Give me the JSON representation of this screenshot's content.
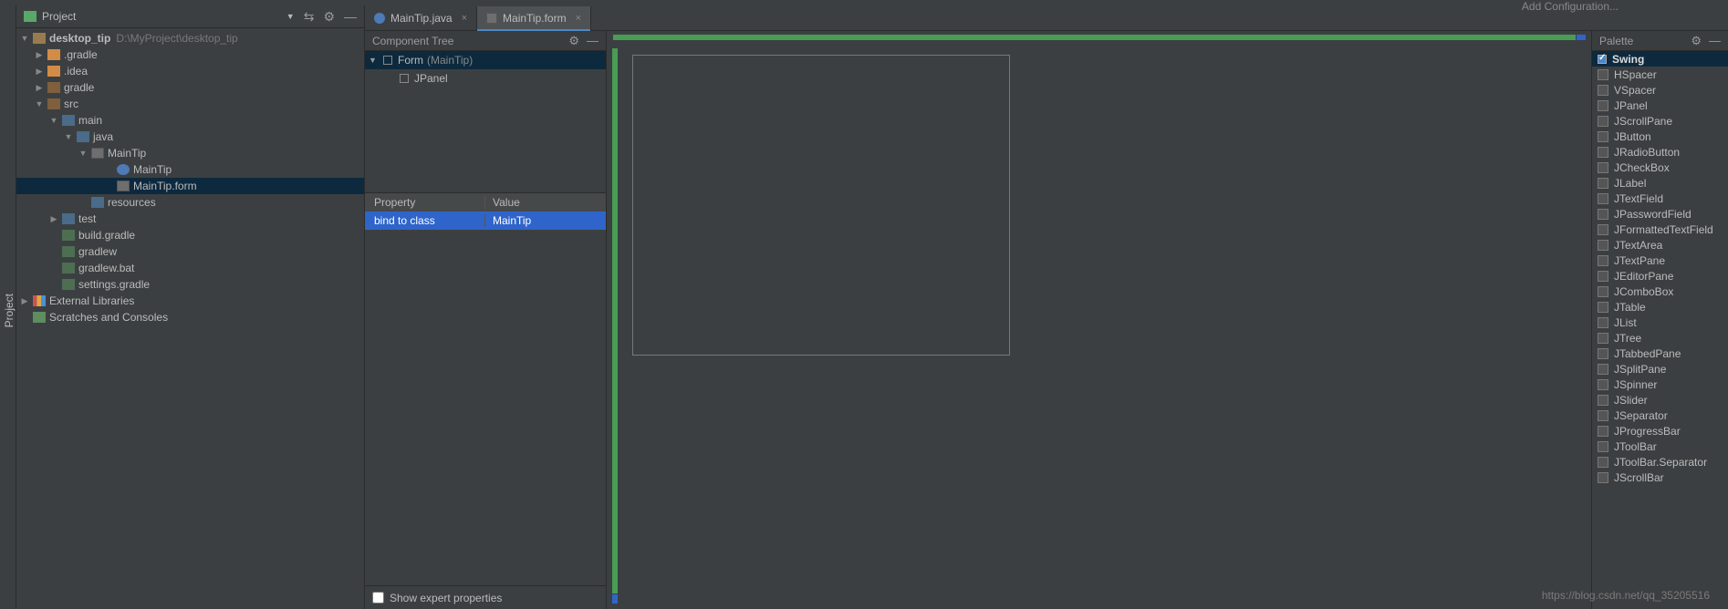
{
  "topbar": {
    "add_config": "Add Configuration..."
  },
  "left_rail": {
    "project": "Project"
  },
  "project": {
    "header": "Project",
    "root": {
      "name": "desktop_tip",
      "path": "D:\\MyProject\\desktop_tip"
    },
    "nodes": {
      "gradle_dot": ".gradle",
      "idea": ".idea",
      "gradle": "gradle",
      "src": "src",
      "main": "main",
      "java": "java",
      "maintip_pkg": "MainTip",
      "maintip_class": "MainTip",
      "maintip_form": "MainTip.form",
      "resources": "resources",
      "test": "test",
      "build_gradle": "build.gradle",
      "gradlew": "gradlew",
      "gradlew_bat": "gradlew.bat",
      "settings_gradle": "settings.gradle",
      "external_libs": "External Libraries",
      "scratches": "Scratches and Consoles"
    }
  },
  "tabs": {
    "t1": "MainTip.java",
    "t2": "MainTip.form"
  },
  "comp_tree": {
    "header": "Component Tree",
    "form": "Form",
    "form_hint": "(MainTip)",
    "jpanel": "JPanel"
  },
  "props": {
    "property": "Property",
    "value": "Value",
    "row1_k": "bind to class",
    "row1_v": "MainTip",
    "expert": "Show expert properties"
  },
  "palette": {
    "header": "Palette",
    "group": "Swing",
    "items": [
      "HSpacer",
      "VSpacer",
      "JPanel",
      "JScrollPane",
      "JButton",
      "JRadioButton",
      "JCheckBox",
      "JLabel",
      "JTextField",
      "JPasswordField",
      "JFormattedTextField",
      "JTextArea",
      "JTextPane",
      "JEditorPane",
      "JComboBox",
      "JTable",
      "JList",
      "JTree",
      "JTabbedPane",
      "JSplitPane",
      "JSpinner",
      "JSlider",
      "JSeparator",
      "JProgressBar",
      "JToolBar",
      "JToolBar.Separator",
      "JScrollBar"
    ]
  },
  "watermark": "https://blog.csdn.net/qq_35205516"
}
